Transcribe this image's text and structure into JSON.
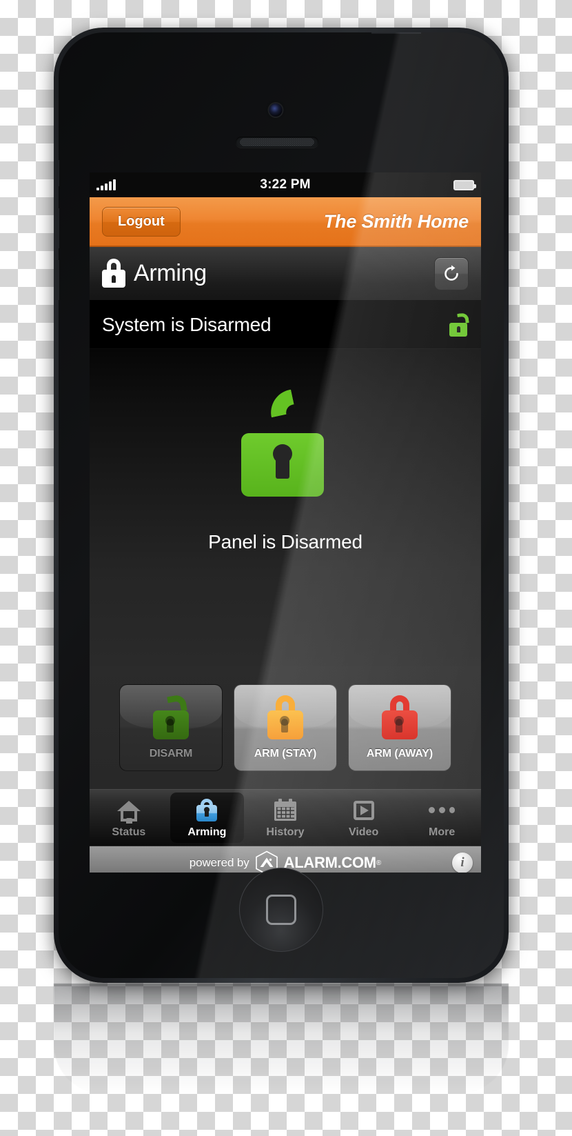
{
  "status_bar": {
    "signal_icon": "signal-bars-icon",
    "time": "3:22 PM",
    "battery_icon": "battery-icon"
  },
  "navbar": {
    "logout_label": "Logout",
    "home_name": "The Smith Home",
    "accent_color": "#ef8632"
  },
  "title_bar": {
    "lock_icon": "lock-closed-icon",
    "title": "Arming",
    "refresh_icon": "refresh-icon"
  },
  "status_row": {
    "text": "System is Disarmed",
    "icon": "lock-open-icon",
    "icon_color": "#63c222"
  },
  "main": {
    "big_lock_icon": "lock-open-large-icon",
    "big_lock_color": "#64c323",
    "panel_text": "Panel is Disarmed"
  },
  "arm_buttons": [
    {
      "label": "DISARM",
      "icon": "lock-open-icon",
      "color": "#3d7a16",
      "state": "disabled"
    },
    {
      "label": "ARM (STAY)",
      "icon": "lock-closed-icon",
      "color": "#f9a11b",
      "state": "active"
    },
    {
      "label": "ARM (AWAY)",
      "icon": "lock-closed-icon",
      "color": "#e0251b",
      "state": "active"
    }
  ],
  "tabs": [
    {
      "label": "Status",
      "icon": "house-icon",
      "active": false
    },
    {
      "label": "Arming",
      "icon": "lock-icon",
      "active": true
    },
    {
      "label": "History",
      "icon": "calendar-icon",
      "active": false
    },
    {
      "label": "Video",
      "icon": "play-icon",
      "active": false
    },
    {
      "label": "More",
      "icon": "ellipsis-icon",
      "active": false
    }
  ],
  "footer": {
    "powered_by": "powered by",
    "brand": "ALARM.COM",
    "registered_mark": "®",
    "brand_icon": "alarm-com-hex-logo",
    "info_label": "i"
  }
}
